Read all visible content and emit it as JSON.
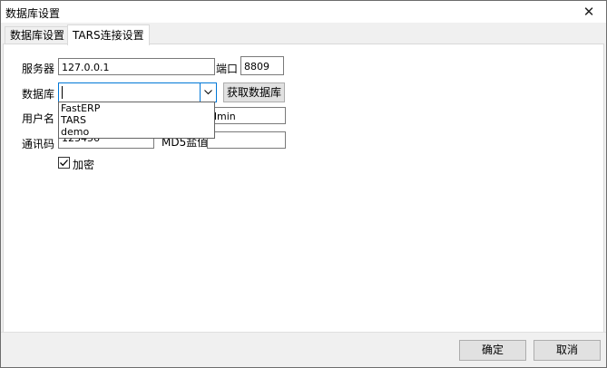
{
  "window": {
    "title": "数据库设置",
    "close_symbol": "✕"
  },
  "tabs": [
    {
      "label": "数据库设置",
      "active": false
    },
    {
      "label": "TARS连接设置",
      "active": true
    }
  ],
  "form": {
    "server_label": "服务器",
    "server_value": "127.0.0.1",
    "port_label": "端口",
    "port_value": "8809",
    "database_label": "数据库",
    "database_value": "",
    "database_options": [
      "FastERP",
      "TARS",
      "demo"
    ],
    "fetch_button": "获取数据库",
    "username_label": "用户名",
    "username_value_visible": "dmin",
    "password_label": "通讯码",
    "password_value_visible": "123456",
    "md5_label_visible": "MD5盐值",
    "md5_value": "",
    "encrypt_label": "加密",
    "encrypt_checked": true
  },
  "footer": {
    "ok_label": "确定",
    "cancel_label": "取消"
  }
}
